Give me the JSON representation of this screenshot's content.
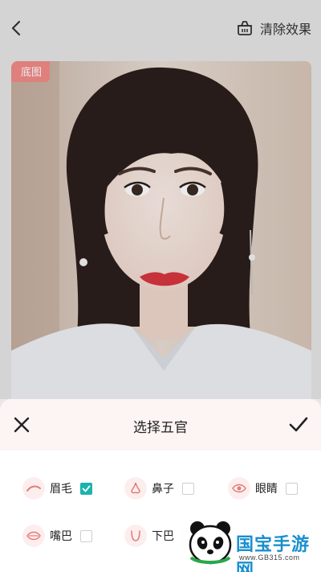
{
  "header": {
    "back_icon": "chevron-left-icon",
    "clear_icon": "basket-icon",
    "clear_label": "清除效果"
  },
  "photo": {
    "tag": "底图"
  },
  "sheet": {
    "title": "选择五官",
    "close_icon": "close-icon",
    "confirm_icon": "check-icon",
    "features": [
      {
        "label": "眉毛",
        "icon": "eyebrow-icon",
        "checked": true
      },
      {
        "label": "鼻子",
        "icon": "nose-icon",
        "checked": false
      },
      {
        "label": "眼睛",
        "icon": "eye-icon",
        "checked": false
      },
      {
        "label": "嘴巴",
        "icon": "mouth-icon",
        "checked": false
      },
      {
        "label": "下巴",
        "icon": "chin-icon",
        "checked": false
      }
    ]
  },
  "watermark": {
    "brand": "国宝手游网",
    "url": "www.GB315.com"
  },
  "colors": {
    "accent_pink": "#f28b88",
    "check_teal": "#1bb3ad",
    "sheet_header_bg": "#fdf4f4"
  }
}
